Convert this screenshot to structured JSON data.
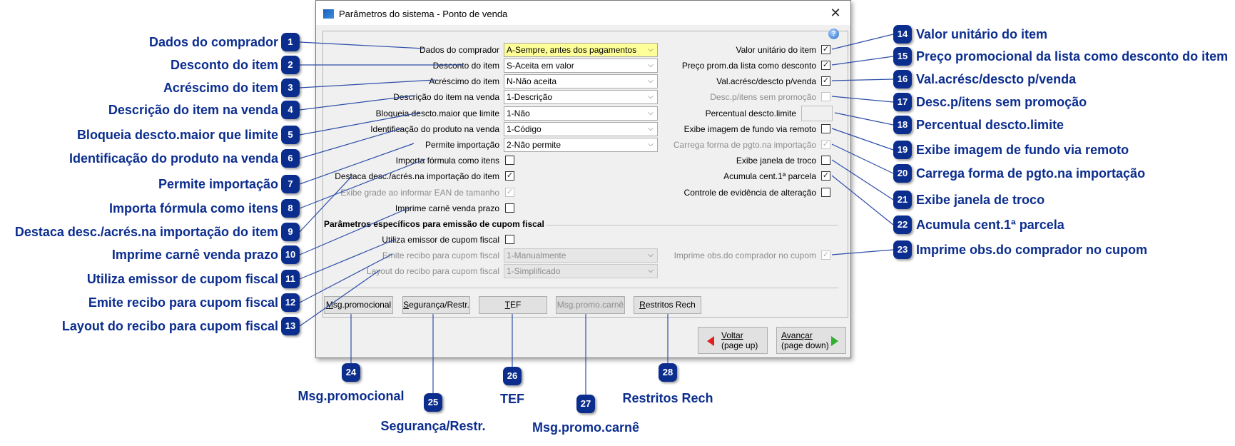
{
  "window": {
    "title": "Parâmetros do sistema - Ponto de venda",
    "close_glyph": "✕",
    "help_glyph": "?"
  },
  "left_fields": [
    {
      "label": "Dados do comprador",
      "type": "combo",
      "value": "A-Sempre, antes dos pagamentos",
      "highlighted": true
    },
    {
      "label": "Desconto do item",
      "type": "combo",
      "value": "S-Aceita em valor"
    },
    {
      "label": "Acréscimo do item",
      "type": "combo",
      "value": "N-Não aceita"
    },
    {
      "label": "Descrição do item na venda",
      "type": "combo",
      "value": "1-Descrição"
    },
    {
      "label": "Bloqueia descto.maior que limite",
      "type": "combo",
      "value": "1-Não"
    },
    {
      "label": "Identificação do produto na venda",
      "type": "combo",
      "value": "1-Código"
    },
    {
      "label": "Permite importação",
      "type": "combo",
      "value": "2-Não permite"
    },
    {
      "label": "Importa fórmula como itens",
      "type": "checkbox",
      "checked": false
    },
    {
      "label": "Destaca desc./acrés.na importação do item",
      "type": "checkbox",
      "checked": true
    },
    {
      "label": "Exibe grade ao informar EAN de tamanho",
      "type": "checkbox",
      "checked": true,
      "disabled": true
    },
    {
      "label": "Imprime carnê venda prazo",
      "type": "checkbox",
      "checked": false
    }
  ],
  "right_fields": [
    {
      "label": "Valor unitário do item",
      "type": "checkbox",
      "checked": true
    },
    {
      "label": "Preço prom.da lista como desconto",
      "type": "checkbox",
      "checked": true
    },
    {
      "label": "Val.acrésc/descto p/venda",
      "type": "checkbox",
      "checked": true
    },
    {
      "label": "Desc.p/itens sem promoção",
      "type": "checkbox",
      "checked": false,
      "disabled": true
    },
    {
      "label": "Percentual descto.limite",
      "type": "input",
      "value": ""
    },
    {
      "label": "Exibe imagem de fundo via remoto",
      "type": "checkbox",
      "checked": false
    },
    {
      "label": "Carrega forma de pgto.na importação",
      "type": "checkbox",
      "checked": true,
      "disabled": true
    },
    {
      "label": "Exibe janela de troco",
      "type": "checkbox",
      "checked": false
    },
    {
      "label": "Acumula cent.1ª parcela",
      "type": "checkbox",
      "checked": true
    },
    {
      "label": "Controle de evidência de alteração",
      "type": "checkbox",
      "checked": false
    }
  ],
  "section_title": "Parâmetros específicos para emissão de cupom fiscal",
  "fiscal_left": [
    {
      "label": "Utiliza emissor de cupom fiscal",
      "type": "checkbox",
      "checked": false
    },
    {
      "label": "Emite recibo para cupom fiscal",
      "type": "combo",
      "value": "1-Manualmente",
      "disabled": true
    },
    {
      "label": "Layout do recibo para cupom fiscal",
      "type": "combo",
      "value": "1-Simplificado",
      "disabled": true
    }
  ],
  "fiscal_right": [
    {
      "label": "Imprime obs.do comprador no cupom",
      "type": "checkbox",
      "checked": true,
      "disabled": true
    }
  ],
  "buttons": [
    {
      "label": "Msg.promocional",
      "mnemonic": 0
    },
    {
      "label": "Segurança/Restr.",
      "mnemonic": 0
    },
    {
      "label": "TEF",
      "mnemonic": 0
    },
    {
      "label": "Msg.promo.carnê",
      "mnemonic": 2,
      "disabled": true
    },
    {
      "label": "Restritos Rech",
      "mnemonic": 0
    }
  ],
  "nav": {
    "back": {
      "label": "Voltar",
      "sub": "(page up)"
    },
    "next": {
      "label": "Avançar",
      "sub": "(page down)"
    }
  },
  "callouts": [
    {
      "n": "1",
      "text": "Dados do comprador"
    },
    {
      "n": "2",
      "text": "Desconto do item"
    },
    {
      "n": "3",
      "text": "Acréscimo do item"
    },
    {
      "n": "4",
      "text": "Descrição do item na venda"
    },
    {
      "n": "5",
      "text": "Bloqueia descto.maior que limite"
    },
    {
      "n": "6",
      "text": "Identificação do produto na venda"
    },
    {
      "n": "7",
      "text": "Permite importação"
    },
    {
      "n": "8",
      "text": "Importa fórmula como itens"
    },
    {
      "n": "9",
      "text": "Destaca desc./acrés.na importação do item"
    },
    {
      "n": "10",
      "text": "Imprime carnê venda prazo"
    },
    {
      "n": "11",
      "text": "Utiliza emissor de cupom fiscal"
    },
    {
      "n": "12",
      "text": "Emite recibo para cupom fiscal"
    },
    {
      "n": "13",
      "text": "Layout do recibo para cupom fiscal"
    },
    {
      "n": "14",
      "text": "Valor unitário do item"
    },
    {
      "n": "15",
      "text": "Preço promocional da lista como desconto do item"
    },
    {
      "n": "16",
      "text": "Val.acrésc/descto p/venda"
    },
    {
      "n": "17",
      "text": "Desc.p/itens sem promoção"
    },
    {
      "n": "18",
      "text": "Percentual descto.limite"
    },
    {
      "n": "19",
      "text": "Exibe imagem de fundo via remoto"
    },
    {
      "n": "20",
      "text": "Carrega forma de pgto.na importação"
    },
    {
      "n": "21",
      "text": "Exibe janela de troco"
    },
    {
      "n": "22",
      "text": "Acumula cent.1ª parcela"
    },
    {
      "n": "23",
      "text": "Imprime obs.do comprador no cupom"
    },
    {
      "n": "24",
      "text": "Msg.promocional"
    },
    {
      "n": "25",
      "text": "Segurança/Restr."
    },
    {
      "n": "26",
      "text": "TEF"
    },
    {
      "n": "27",
      "text": "Msg.promo.carnê"
    },
    {
      "n": "28",
      "text": "Restritos Rech"
    }
  ],
  "colors": {
    "callout": "#0b2d8e",
    "highlight": "#ffff99",
    "leader": "#2e4fa8"
  }
}
